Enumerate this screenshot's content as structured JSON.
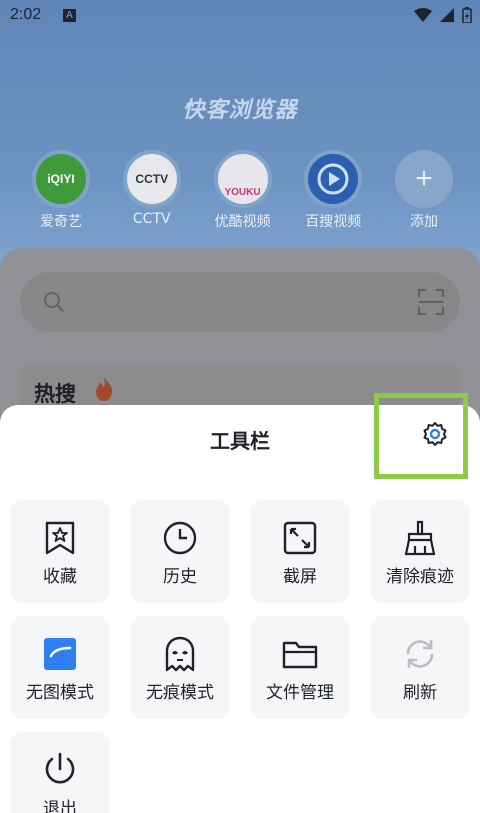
{
  "status_bar": {
    "time": "2:02",
    "app_badge": "A"
  },
  "app_title": "快客浏览器",
  "shortcuts": [
    {
      "label": "爱奇艺",
      "logo_text": "iQIYI",
      "icon": "iqiyi-logo"
    },
    {
      "label": "CCTV",
      "logo_text": "CCTV",
      "icon": "cctv-logo"
    },
    {
      "label": "优酷视频",
      "logo_text": "YOUKU",
      "icon": "youku-logo"
    },
    {
      "label": "百搜视频",
      "logo_text": "",
      "icon": "baisou-logo"
    },
    {
      "label": "添加",
      "logo_text": "+",
      "icon": "plus-icon"
    }
  ],
  "search": {
    "icon_left": "search-icon",
    "icon_right": "scan-icon"
  },
  "hot": {
    "title": "热搜",
    "icon": "flame-icon"
  },
  "toolbar": {
    "title": "工具栏",
    "settings_icon": "gear-icon",
    "accent": "#2f7ff0",
    "highlight": "#8ccc46",
    "items": [
      {
        "label": "收藏",
        "icon": "bookmark-star-icon"
      },
      {
        "label": "历史",
        "icon": "clock-icon"
      },
      {
        "label": "截屏",
        "icon": "screenshot-icon"
      },
      {
        "label": "清除痕迹",
        "icon": "broom-icon"
      },
      {
        "label": "无图模式",
        "icon": "no-image-icon"
      },
      {
        "label": "无痕模式",
        "icon": "incognito-ghost-icon"
      },
      {
        "label": "文件管理",
        "icon": "folder-icon"
      },
      {
        "label": "刷新",
        "icon": "refresh-icon"
      },
      {
        "label": "退出",
        "icon": "power-icon"
      }
    ]
  }
}
